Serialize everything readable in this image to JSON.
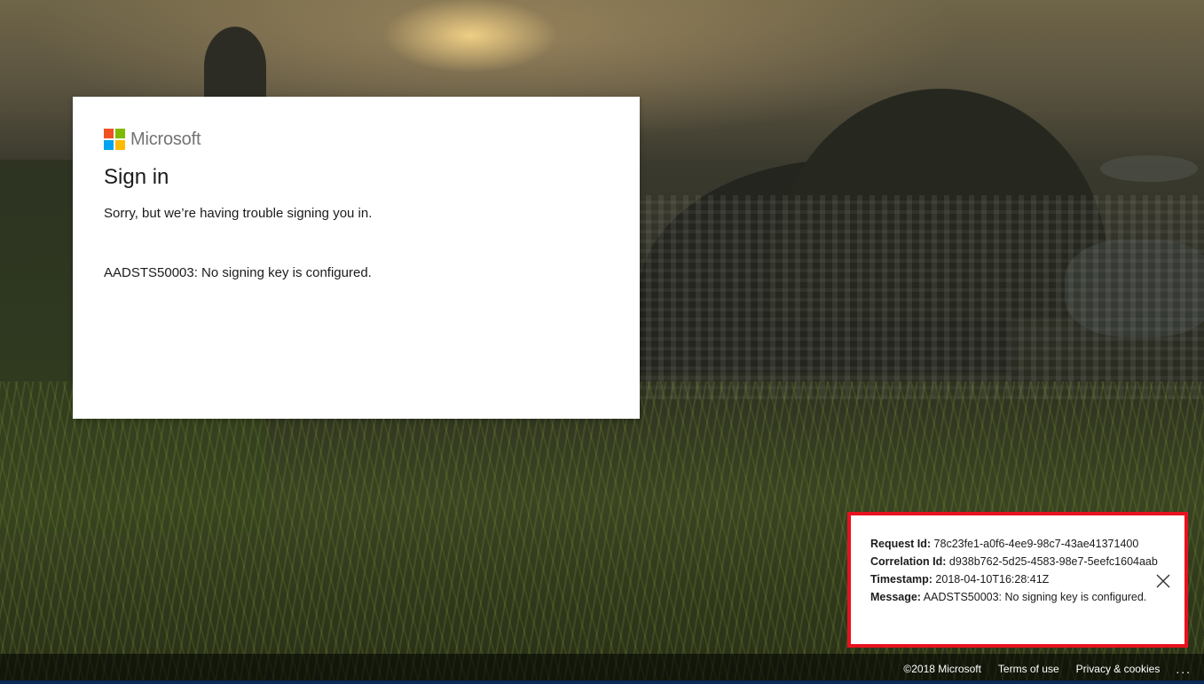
{
  "brand": {
    "name": "Microsoft",
    "logo_colors": [
      "#f25022",
      "#7fba00",
      "#00a4ef",
      "#ffb900"
    ]
  },
  "card": {
    "title": "Sign in",
    "subtitle": "Sorry, but we’re having trouble signing you in.",
    "error": "AADSTS50003: No signing key is configured."
  },
  "details": {
    "request_id_label": "Request Id:",
    "request_id": "78c23fe1-a0f6-4ee9-98c7-43ae41371400",
    "correlation_id_label": "Correlation Id:",
    "correlation_id": "d938b762-5d25-4583-98e7-5eefc1604aab",
    "timestamp_label": "Timestamp:",
    "timestamp": "2018-04-10T16:28:41Z",
    "message_label": "Message:",
    "message": "AADSTS50003: No signing key is configured.",
    "close_icon": "close-icon",
    "border_color": "#e8121e"
  },
  "footer": {
    "copyright": "©2018 Microsoft",
    "terms": "Terms of use",
    "privacy": "Privacy & cookies",
    "more": "..."
  }
}
